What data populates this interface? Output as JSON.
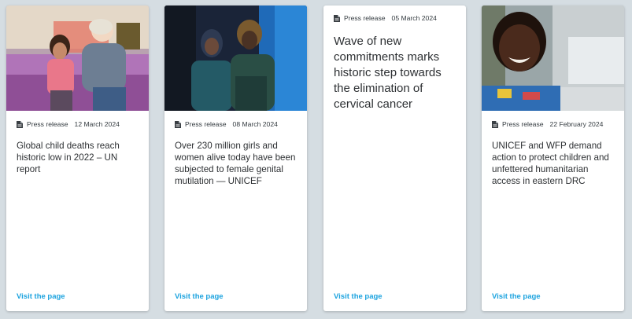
{
  "cards": [
    {
      "type": "Press release",
      "date": "12 March 2024",
      "title": "Global child deaths reach historic low in 2022 – UN report",
      "link": "Visit the page"
    },
    {
      "type": "Press release",
      "date": "08 March 2024",
      "title": "Over 230 million girls and women alive today have been subjected to female genital mutilation — UNICEF",
      "link": "Visit the page"
    },
    {
      "type": "Press release",
      "date": "05 March 2024",
      "title": "Wave of new commitments marks historic step towards the elimination of cervical cancer",
      "link": "Visit the page"
    },
    {
      "type": "Press release",
      "date": "22 February 2024",
      "title": "UNICEF and WFP demand action to protect children and unfettered humanitarian access in eastern DRC",
      "link": "Visit the page"
    }
  ],
  "colors": {
    "background": "#d5dde2",
    "link": "#1ca3df",
    "text": "#2d3033"
  },
  "icons": {
    "press_release": "document-icon"
  }
}
